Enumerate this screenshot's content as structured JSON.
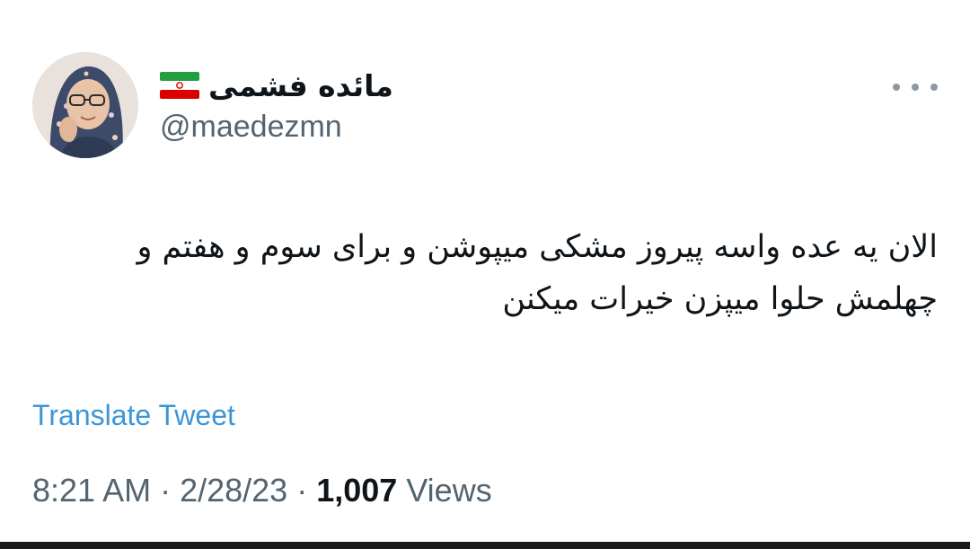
{
  "author": {
    "display_name": "مائده فشمی",
    "handle": "@maedezmn",
    "flag_icon": "iran-flag-icon"
  },
  "tweet": {
    "text": "الان یه عده واسه پیروز مشکی میپوشن و برای سوم و هفتم و چهلمش حلوا میپزن خیرات میکنن",
    "translate_label": "Translate Tweet",
    "time": "8:21 AM",
    "separator": " · ",
    "date": "2/28/23",
    "views_count": "1,007",
    "views_label": " Views"
  },
  "colors": {
    "link": "#3a96d6",
    "secondary_text": "#536471",
    "primary_text": "#0f1419"
  }
}
